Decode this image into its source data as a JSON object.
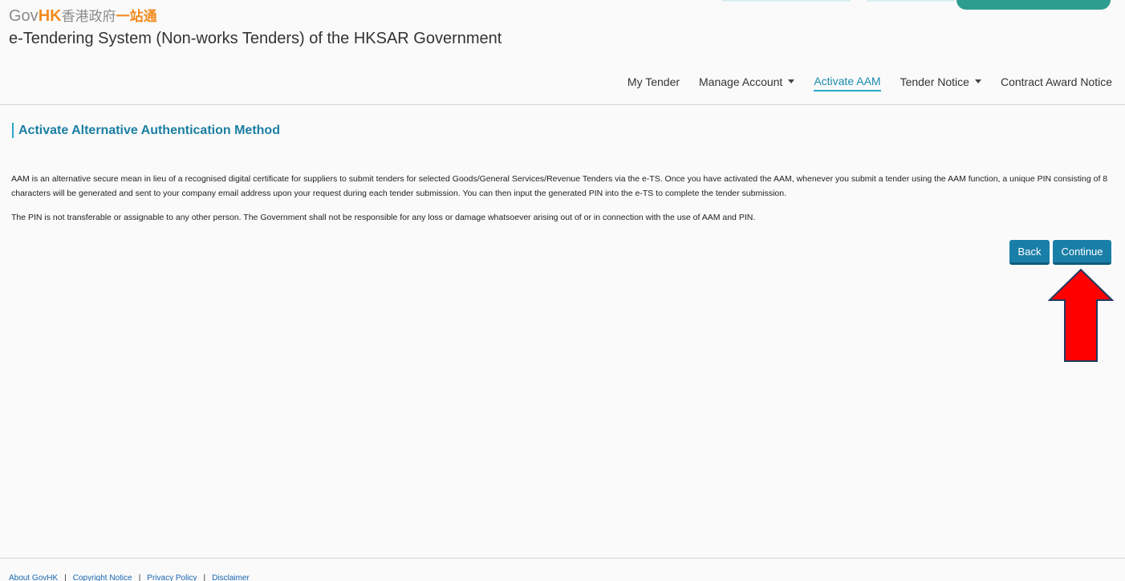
{
  "header": {
    "logo": {
      "gov": "Gov",
      "hk": "HK",
      "zh1": "香港政府",
      "zh2": "一站通"
    },
    "title": "e-Tendering System (Non-works Tenders) of the HKSAR Government"
  },
  "nav": {
    "items": [
      {
        "label": "My Tender",
        "has_dropdown": false,
        "active": false
      },
      {
        "label": "Manage Account",
        "has_dropdown": true,
        "active": false
      },
      {
        "label": "Activate AAM",
        "has_dropdown": false,
        "active": true
      },
      {
        "label": "Tender Notice",
        "has_dropdown": true,
        "active": false
      },
      {
        "label": "Contract Award Notice",
        "has_dropdown": false,
        "active": false
      }
    ]
  },
  "main": {
    "heading": "Activate Alternative Authentication Method",
    "paragraph1": "AAM is an alternative secure mean in lieu of a recognised digital certificate for suppliers to submit tenders for selected Goods/General Services/Revenue Tenders via the e-TS. Once you have activated the AAM, whenever you submit a tender using the AAM function, a unique PIN consisting of 8 characters will be generated and sent to your company email address upon your request during each tender submission. You can then input the generated PIN into the e-TS to complete the tender submission.",
    "paragraph2": "The PIN is not transferable or assignable to any other person. The Government shall not be responsible for any loss or damage whatsoever arising out of or in connection with the use of AAM and PIN.",
    "back_label": "Back",
    "continue_label": "Continue"
  },
  "footer": {
    "links": [
      "About GovHK",
      "Copyright Notice",
      "Privacy Policy",
      "Disclaimer"
    ],
    "separator": "|"
  },
  "colors": {
    "accent": "#1a7fa8",
    "heading": "#1b7fa3",
    "brand_orange": "#f28b1e",
    "annotation_arrow": "#ff0000"
  }
}
